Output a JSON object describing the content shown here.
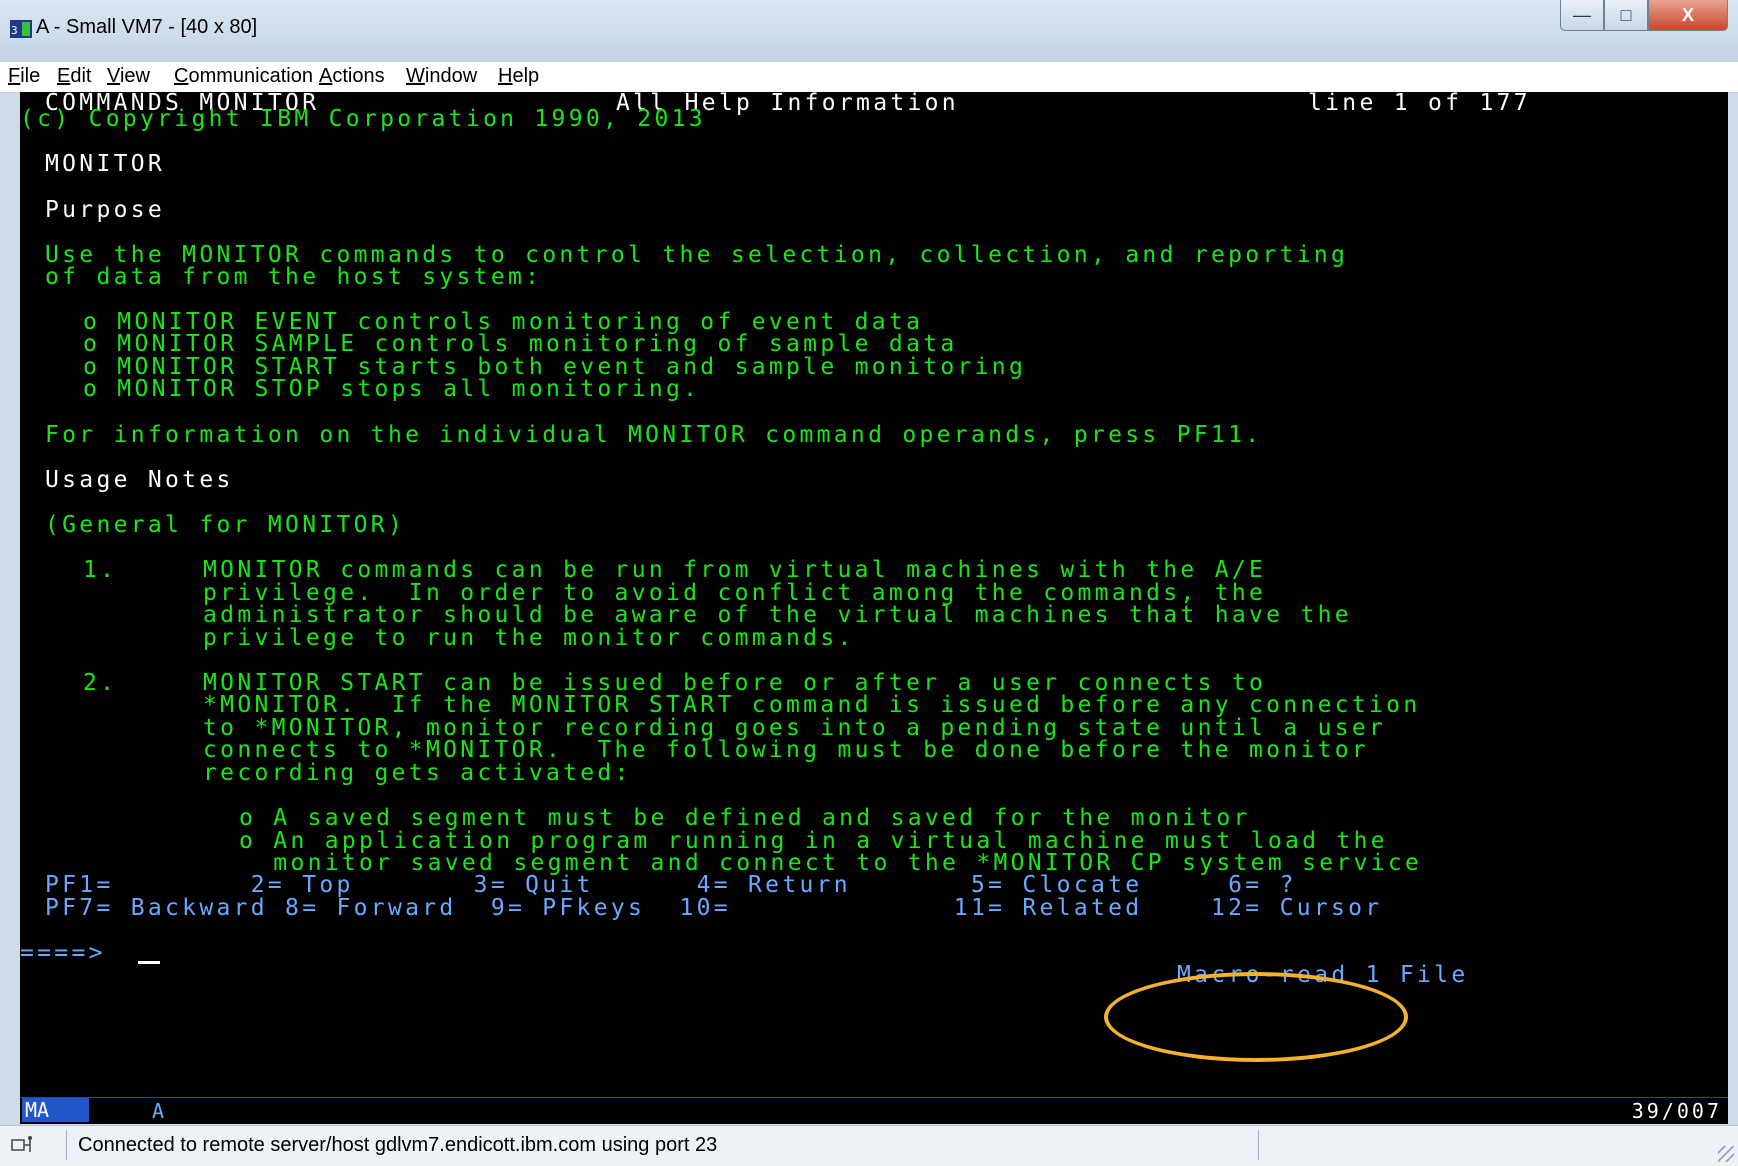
{
  "window": {
    "title": "A - Small VM7 - [40 x 80]",
    "buttons": [
      "minimize",
      "maximize",
      "close"
    ]
  },
  "menu": [
    {
      "label": "File"
    },
    {
      "label": "Edit"
    },
    {
      "label": "View"
    },
    {
      "label": "Communication"
    },
    {
      "label": "Actions"
    },
    {
      "label": "Window"
    },
    {
      "label": "Help"
    }
  ],
  "terminal": {
    "header": {
      "title": "COMMANDS MONITOR",
      "subtitle": "All Help Information",
      "line_info": "line 1 of 177",
      "copyright": "(c) Copyright IBM Corporation 1990, 2013"
    },
    "heading": "MONITOR",
    "purpose_label": "Purpose",
    "purpose_text": [
      "Use the MONITOR commands to control the selection, collection, and reporting",
      "of data from the host system:"
    ],
    "bullets": [
      "o MONITOR EVENT controls monitoring of event data",
      "o MONITOR SAMPLE controls monitoring of sample data",
      "o MONITOR START starts both event and sample monitoring",
      "o MONITOR STOP stops all monitoring."
    ],
    "operands_info": "For information on the individual MONITOR command operands, press PF11.",
    "usage_label": "Usage Notes",
    "general": "(General for MONITOR)",
    "note1": [
      "1.     MONITOR commands can be run from virtual machines with the A/E",
      "       privilege.  In order to avoid conflict among the commands, the",
      "       administrator should be aware of the virtual machines that have the",
      "       privilege to run the monitor commands."
    ],
    "note2": [
      "2.     MONITOR START can be issued before or after a user connects to",
      "       *MONITOR.  If the MONITOR START command is issued before any connection",
      "       to *MONITOR, monitor recording goes into a pending state until a user",
      "       connects to *MONITOR.  The following must be done before the monitor",
      "       recording gets activated:"
    ],
    "note2_bullets": [
      "o A saved segment must be defined and saved for the monitor",
      "o An application program running in a virtual machine must load the",
      "  monitor saved segment and connect to the *MONITOR CP system service"
    ],
    "pf_row1": "PF1=        2= Top       3= Quit      4= Return       5= Clocate     6= ?",
    "pf_row2": "PF7= Backward 8= Forward  9= PFkeys  10=             11= Related    12= Cursor",
    "command_prompt": "====>",
    "command_value": "",
    "status_right": "Macro-read 1 File"
  },
  "oia": {
    "mode": "MA",
    "indicator": "A",
    "cursor_position": "39/007"
  },
  "statusbar": {
    "text": "Connected to remote server/host gdlvm7.endicott.ibm.com using port 23"
  },
  "annotation": {
    "highlight_color": "#f4b12c",
    "highlight_target": "11= Related"
  }
}
